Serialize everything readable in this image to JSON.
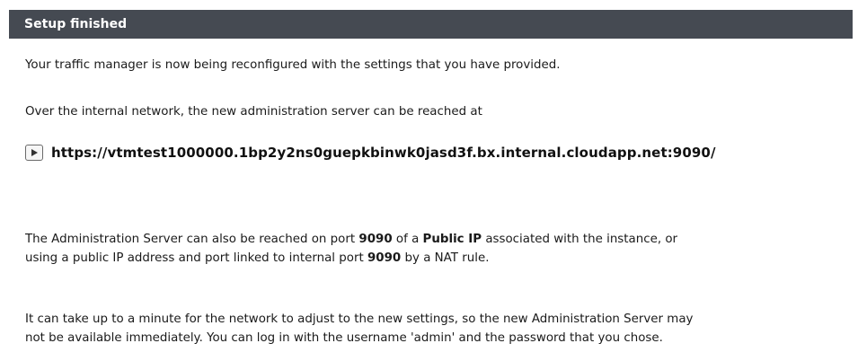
{
  "panel": {
    "title": "Setup finished"
  },
  "body": {
    "p1": "Your traffic manager is now being reconfigured with the settings that you have provided.",
    "p2": "Over the internal network, the new administration server can be reached at",
    "admin_url": "https://vtmtest1000000.1bp2y2ns0guepkbinwk0jasd3f.bx.internal.cloudapp.net:9090/",
    "p3_line1_a": "The Administration Server can also be reached on port ",
    "p3_port_1": "9090",
    "p3_line1_b": " of a ",
    "p3_public_ip": "Public IP",
    "p3_line1_c": " associated with the instance, or",
    "p3_line2_a": "using a public IP address and port linked to internal port ",
    "p3_port_2": "9090",
    "p3_line2_b": " by a NAT rule.",
    "p4_line1": "It can take up to a minute for the network to adjust to the new settings, so the new Administration Server may",
    "p4_line2": "not be available immediately. You can log in with the username 'admin' and the password that you chose."
  },
  "icons": {
    "url_button": "play-icon"
  },
  "colors": {
    "header_bg": "#454a52",
    "header_text": "#ffffff",
    "text": "#1a1a1a"
  }
}
